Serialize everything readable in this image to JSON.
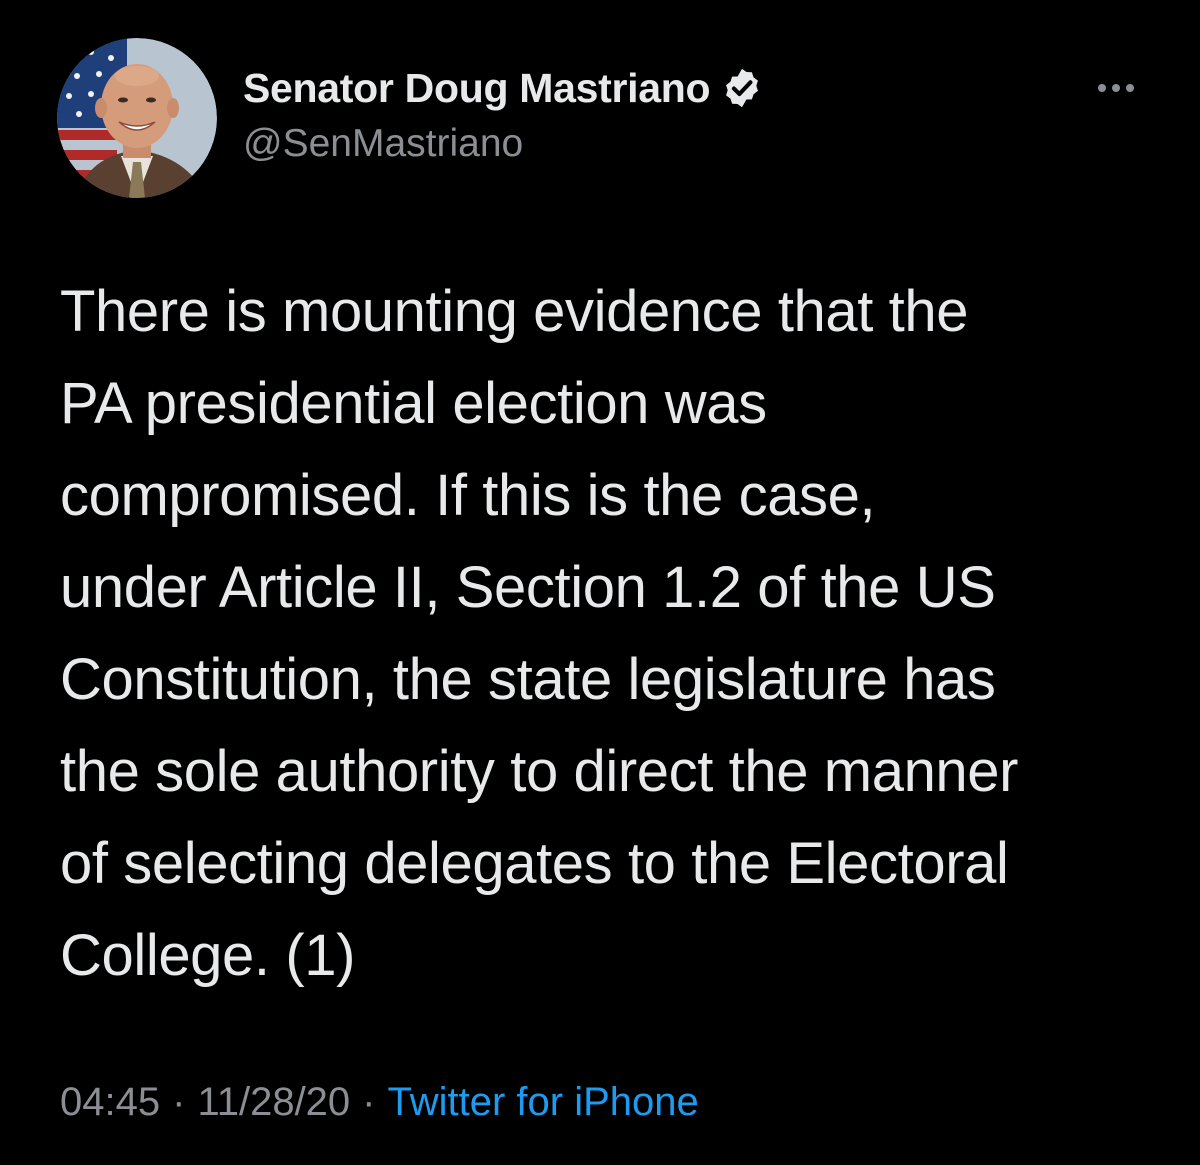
{
  "tweet": {
    "author": {
      "display_name": "Senator Doug Mastriano",
      "handle": "@SenMastriano",
      "verified_icon": "verified-badge-icon",
      "avatar_icon": "profile-photo"
    },
    "more_icon": "more-options-icon",
    "text": "There is mounting evidence that the\nPA presidential election was\ncompromised.  If this is the case,\nunder Article II, Section 1.2 of the US\nConstitution, the state legislature has\nthe sole authority to direct the manner\nof selecting delegates to the Electoral\nCollege. (1)",
    "time": "04:45",
    "date": "11/28/20",
    "separator": "·",
    "source": "Twitter for iPhone"
  },
  "colors": {
    "background": "#000000",
    "primary_text": "#e7e9ea",
    "secondary_text": "#8b8f94",
    "link": "#1d9bf0"
  }
}
